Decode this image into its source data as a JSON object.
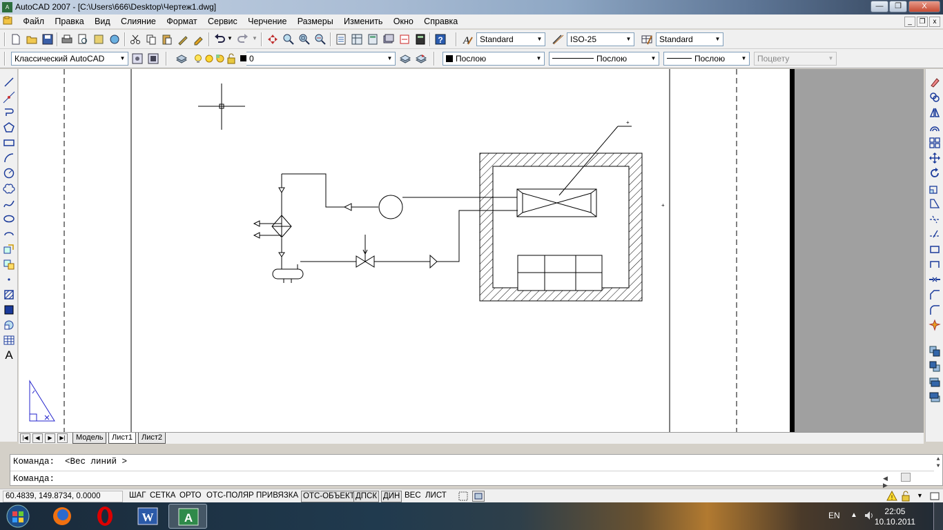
{
  "window": {
    "title": "AutoCAD 2007 - [C:\\Users\\666\\Desktop\\Чертеж1.dwg]",
    "app_icon_text": "A",
    "minimize": "—",
    "maximize": "❐",
    "close": "X"
  },
  "menu": [
    "Файл",
    "Правка",
    "Вид",
    "Слияние",
    "Формат",
    "Сервис",
    "Черчение",
    "Размеры",
    "Изменить",
    "Окно",
    "Справка"
  ],
  "mdi": {
    "minimize": "_",
    "restore": "❐",
    "close": "x"
  },
  "styles_toolbar": {
    "text_style": "Standard",
    "dim_style": "ISO-25",
    "table_style": "Standard"
  },
  "layers_toolbar": {
    "workspace": "Классический AutoCAD",
    "layer": "0",
    "color": "Послою",
    "linetype": "Послою",
    "lineweight": "Послою",
    "plotstyle": "Поцвету"
  },
  "layout_tabs": [
    "Модель",
    "Лист1",
    "Лист2"
  ],
  "active_tab": "Лист1",
  "nav_buttons": [
    "|◀",
    "◀",
    "▶",
    "▶|"
  ],
  "command": {
    "history": "Команда:  <Вес линий >",
    "prompt": "Команда:"
  },
  "status": {
    "coords": "60.4839,  149.8734, 0.0000",
    "toggles": [
      "ШАГ",
      "СЕТКА",
      "ОРТО",
      "ОТС-ПОЛЯР",
      "ПРИВЯЗКА",
      "ОТС-ОБЪЕКТ",
      "ДПСК",
      "ДИН",
      "ВЕС",
      "ЛИСТ"
    ],
    "toggles_on": [
      "ОТС-ОБЪЕКТ",
      "ДПСК",
      "ДИН"
    ]
  },
  "taskbar": {
    "lang": "EN",
    "time": "22:05",
    "date": "10.10.2011"
  },
  "colors": {
    "ucs_icon": "#2222cc",
    "drawing": "#000000",
    "paper": "#ffffff",
    "background": "#a0a0a0"
  }
}
